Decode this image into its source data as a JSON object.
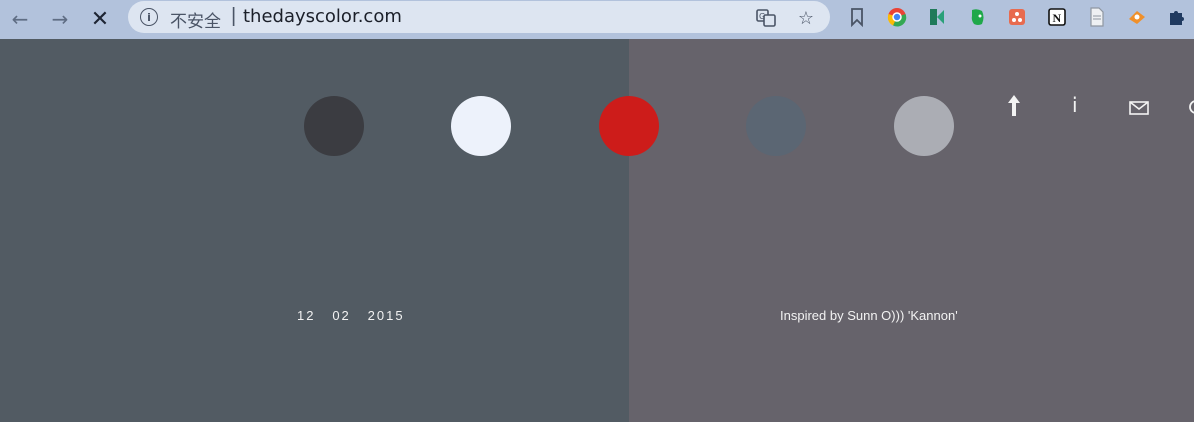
{
  "browser": {
    "security_label": "不安全",
    "url": "thedayscolor.com",
    "separator": "|"
  },
  "page": {
    "left_background": "#525b63",
    "right_background": "#66636b",
    "swatches": [
      {
        "color": "#3b3c41"
      },
      {
        "color": "#edf2fb"
      },
      {
        "color": "#cd1c1a"
      },
      {
        "color": "#5b6673"
      },
      {
        "color": "#abadb4"
      }
    ],
    "date": {
      "day": "12",
      "month": "02",
      "year": "2015"
    },
    "inspiration": "Inspired by Sunn O))) 'Kannon'",
    "icons": [
      "upload-icon",
      "info-icon",
      "mail-icon"
    ]
  }
}
